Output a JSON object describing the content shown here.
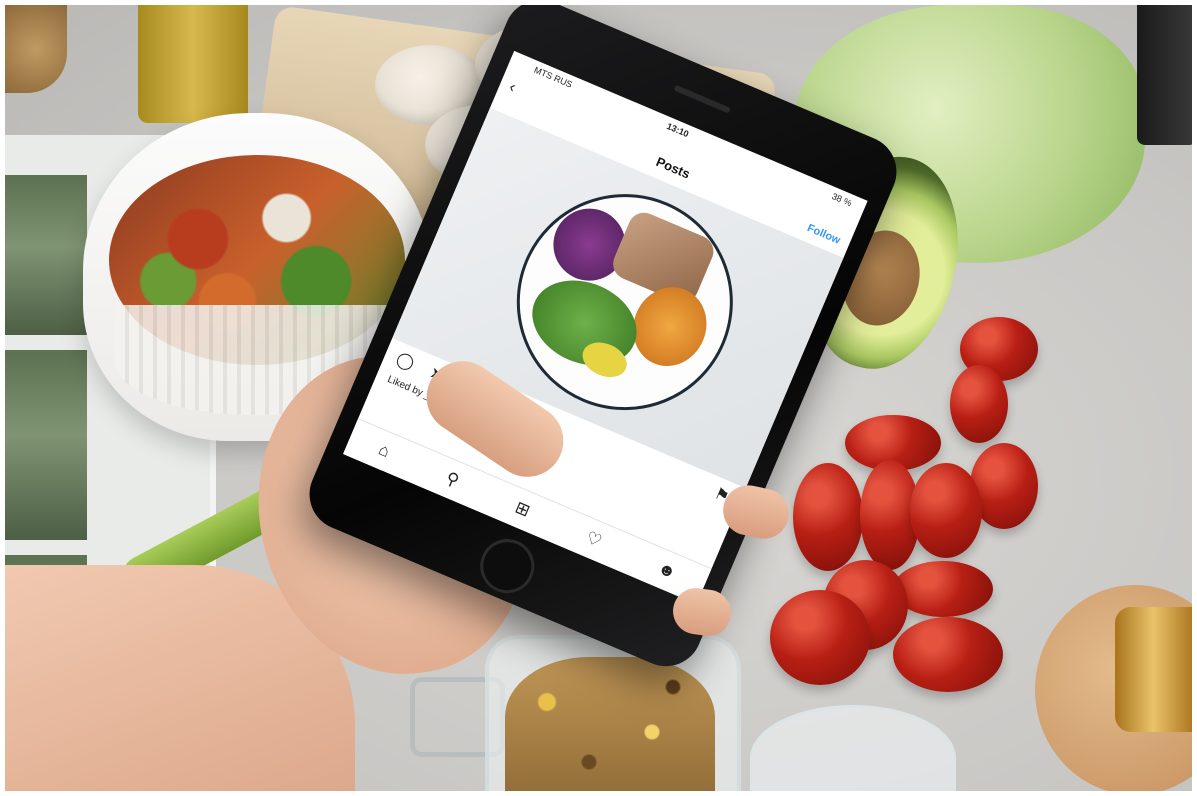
{
  "phone": {
    "status": {
      "carrier": "MTS RUS",
      "time": "13:10",
      "battery": "38 %"
    },
    "header": {
      "back_icon": "back-arrow-icon",
      "username": "",
      "title": "Posts",
      "follow": "Follow"
    },
    "post": {
      "liked_by": "Liked by ___ and others",
      "caption": ""
    },
    "tabs": [
      "home-icon",
      "search-icon",
      "add-icon",
      "heart-icon",
      "profile-icon"
    ]
  }
}
